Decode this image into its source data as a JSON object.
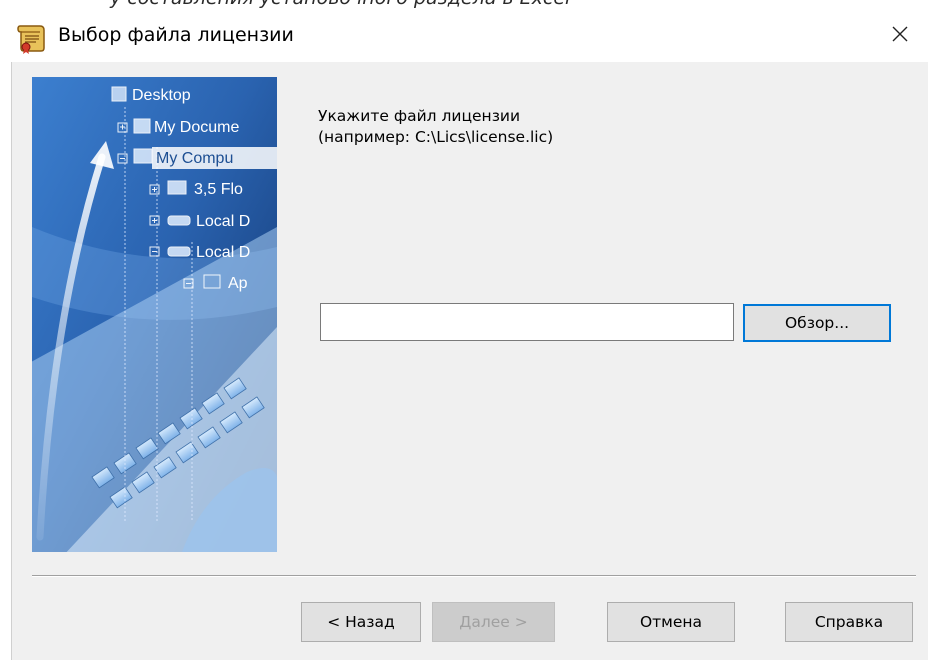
{
  "window": {
    "title": "Выбор файла лицензии",
    "close_glyph": "✕"
  },
  "backdrop": {
    "partial_text": "у составления установочного раздела в Excel"
  },
  "illustration": {
    "tree_items": [
      "Desktop",
      "My Docume",
      "My Compu",
      "3,5 Flo",
      "Local D",
      "Local D",
      "Ap"
    ]
  },
  "instructions": {
    "line1": "Укажите файл лицензии",
    "line2": "(например: C:\\Lics\\license.lic)"
  },
  "license_path": {
    "value": "",
    "placeholder": ""
  },
  "buttons": {
    "browse": "Обзор...",
    "back": "< Назад",
    "next": "Далее >",
    "cancel": "Отмена",
    "help": "Справка"
  },
  "colors": {
    "dialog_bg": "#f0f0f0",
    "accent_focus": "#0078d7",
    "illustration_bg": "#1d4f93"
  }
}
